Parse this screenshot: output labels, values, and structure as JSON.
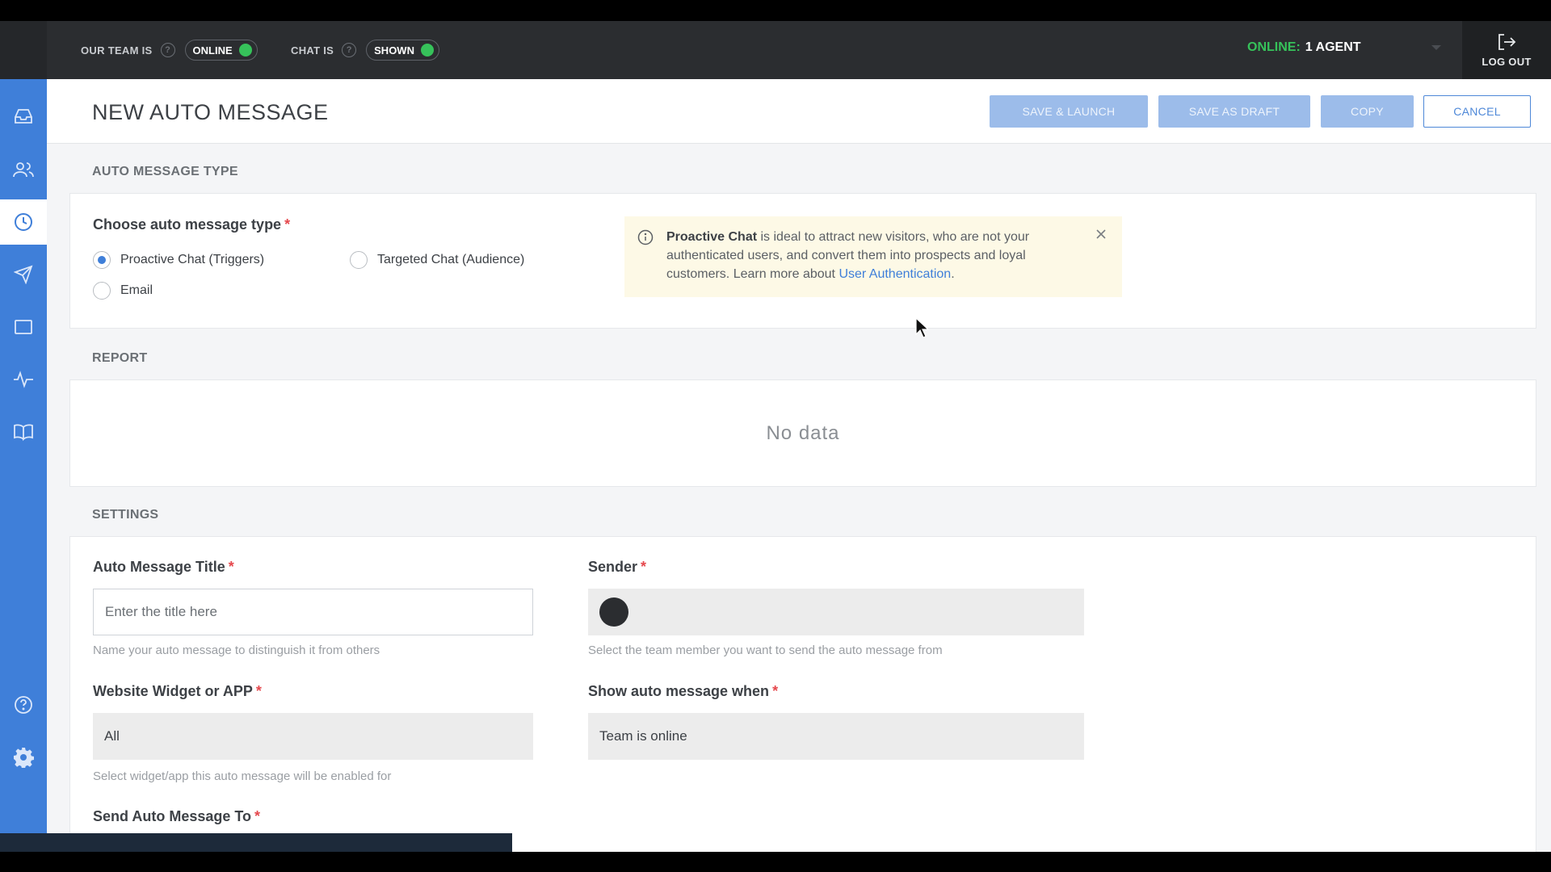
{
  "topbar": {
    "team_label": "OUR TEAM IS",
    "team_status": "ONLINE",
    "chat_label": "CHAT IS",
    "chat_status": "SHOWN",
    "online_key": "ONLINE:",
    "online_value": "1 AGENT",
    "logout_label": "LOG OUT",
    "status_color": "#36c25a"
  },
  "sidebar": {
    "items": [
      {
        "icon": "inbox-icon"
      },
      {
        "icon": "contacts-icon"
      },
      {
        "icon": "clock-icon",
        "active": true
      },
      {
        "icon": "send-icon"
      },
      {
        "icon": "widget-icon"
      },
      {
        "icon": "activity-icon"
      },
      {
        "icon": "book-icon"
      },
      {
        "icon": "help-icon"
      },
      {
        "icon": "gear-icon"
      }
    ],
    "accent": "#3f7fd9"
  },
  "header": {
    "title": "NEW AUTO MESSAGE",
    "save_launch": "SAVE & LAUNCH",
    "save_draft": "SAVE AS DRAFT",
    "copy": "COPY",
    "cancel": "CANCEL"
  },
  "type_section": {
    "section_label": "AUTO MESSAGE TYPE",
    "field_label": "Choose auto message type",
    "required_mark": "*",
    "options": [
      {
        "label": "Proactive Chat (Triggers)",
        "checked": true
      },
      {
        "label": "Targeted Chat (Audience)",
        "checked": false
      },
      {
        "label": "Email",
        "checked": false
      }
    ],
    "info": {
      "bold": "Proactive Chat",
      "text": " is ideal to attract new visitors, who are not your authenticated users, and convert them into prospects and loyal customers. Learn more about ",
      "link": "User Authentication",
      "end": "."
    }
  },
  "report_section": {
    "section_label": "REPORT",
    "empty_text": "No data"
  },
  "settings_section": {
    "section_label": "SETTINGS",
    "title_field": {
      "label": "Auto Message Title",
      "placeholder": "Enter the title here",
      "hint": "Name your auto message to distinguish it from others"
    },
    "sender_field": {
      "label": "Sender",
      "hint": "Select the team member you want to send the auto message from"
    },
    "widget_field": {
      "label": "Website Widget or APP",
      "value": "All",
      "hint": "Select widget/app this auto message will be enabled for"
    },
    "show_field": {
      "label": "Show auto message when",
      "value": "Team is online"
    },
    "send_to_field": {
      "label": "Send Auto Message To"
    }
  }
}
